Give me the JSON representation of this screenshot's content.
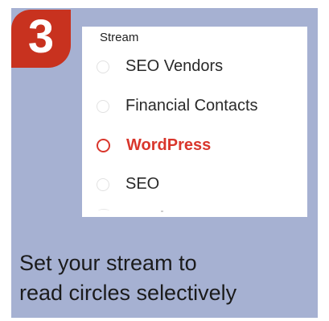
{
  "step": {
    "number": "3",
    "color": "#c8321f"
  },
  "stream_panel": {
    "title": "Stream",
    "items": [
      {
        "label": "SEO Vendors",
        "selected": false
      },
      {
        "label": "Financial Contacts",
        "selected": false
      },
      {
        "label": "WordPress",
        "selected": true
      },
      {
        "label": "SEO",
        "selected": false
      }
    ]
  },
  "caption": {
    "line1": "Set your stream to",
    "line2": "read circles selectively"
  },
  "colors": {
    "card_background": "#a6b1d2",
    "selected_accent": "#d9362c"
  }
}
